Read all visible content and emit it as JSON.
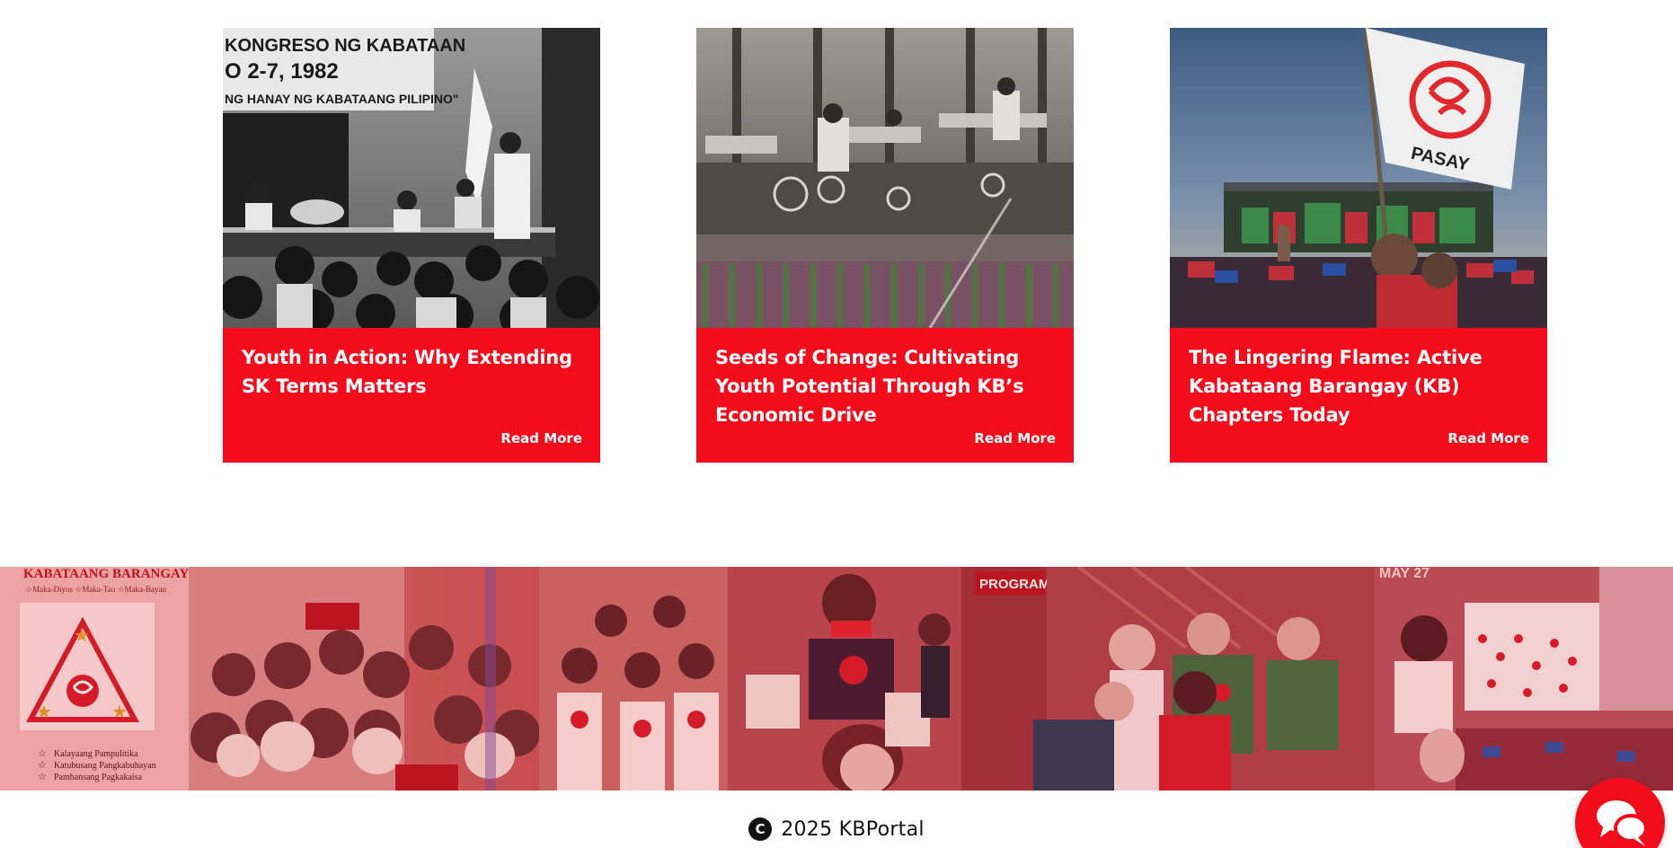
{
  "colors": {
    "accent": "#f30d1c",
    "card_text": "#ffffff",
    "footer_text": "#111111"
  },
  "articles": [
    {
      "title": "Youth in Action: Why Extending SK Terms Matters",
      "read_more": "Read More",
      "image": {
        "banner_line1": "KONGRESO NG KABATAAN",
        "banner_line2": "O 2-7, 1982",
        "banner_line3": "NG HANAY NG KABATAANG PILIPINO\""
      }
    },
    {
      "title": "Seeds of Change: Cultivating Youth Potential Through KB’s Economic Drive",
      "read_more": "Read More"
    },
    {
      "title": "The Lingering Flame: Active Kabataang Barangay (KB) Chapters Today",
      "read_more": "Read More",
      "image": {
        "flag_text": "PASAY"
      }
    }
  ],
  "banner": {
    "poster_title": "KABATAANG BARANGAY",
    "poster_subtitle": "☆Maka-Diyos  ☆Maka-Tao  ☆Maka-Bayan",
    "poster_items": [
      "Kalayaang Pampulitika",
      "Katubusang Pangkabuhayan",
      "Pambansang Pagkakaisa"
    ],
    "sign_text": "PROGRAM",
    "date_text": "MAY 27"
  },
  "footer": {
    "copyright_symbol": "C",
    "copyright_text": "2025  KBPortal"
  },
  "icons": {
    "copyright": "copyright-icon",
    "chat": "chat-bubbles-icon"
  }
}
